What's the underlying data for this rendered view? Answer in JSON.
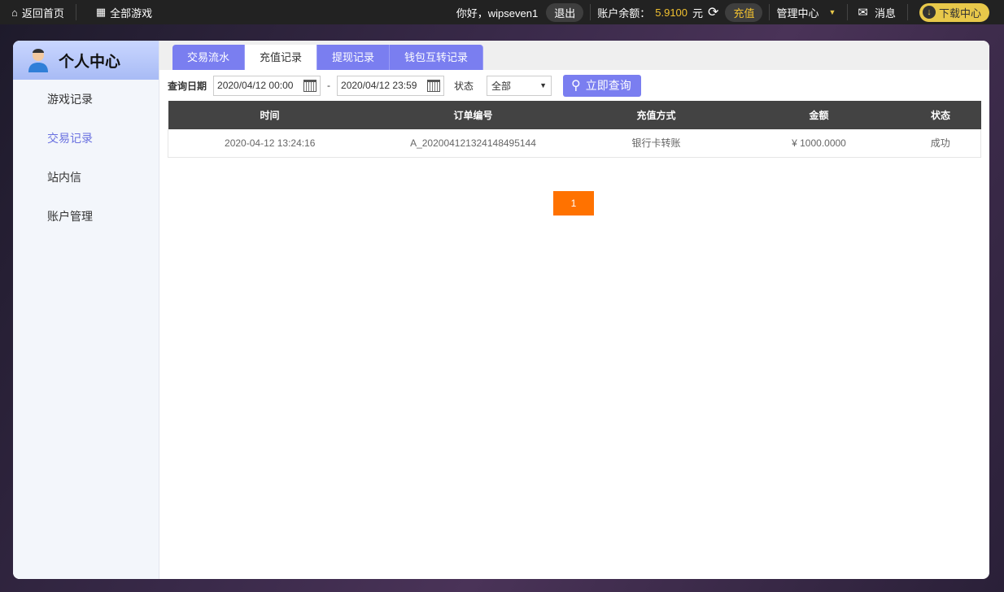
{
  "topbar": {
    "home": "返回首页",
    "all_games": "全部游戏",
    "greeting": "你好，wipseven1",
    "logout": "退出",
    "balance_label": "账户余额：",
    "balance": "5.9100",
    "currency": "元",
    "recharge": "充值",
    "manage": "管理中心",
    "messages": "消息",
    "download": "下载中心"
  },
  "sidebar": {
    "title": "个人中心",
    "items": [
      {
        "label": "游戏记录"
      },
      {
        "label": "交易记录"
      },
      {
        "label": "站内信"
      },
      {
        "label": "账户管理"
      }
    ]
  },
  "tabs": [
    {
      "label": "交易流水"
    },
    {
      "label": "充值记录"
    },
    {
      "label": "提现记录"
    },
    {
      "label": "钱包互转记录"
    }
  ],
  "filter": {
    "date_label": "查询日期",
    "start": "2020/04/12 00:00",
    "dash": "-",
    "end": "2020/04/12 23:59",
    "status_label": "状态",
    "status_value": "全部",
    "query": "立即查询"
  },
  "table": {
    "headers": [
      "时间",
      "订单编号",
      "充值方式",
      "金额",
      "状态"
    ],
    "rows": [
      [
        "2020-04-12 13:24:16",
        "A_202004121324148495144",
        "银行卡转账",
        "¥ 1000.0000",
        "成功"
      ]
    ]
  },
  "pager": {
    "current": "1"
  },
  "colors": {
    "accent": "#7a7ef0",
    "pager": "#ff7200",
    "balance": "#f0c030"
  }
}
